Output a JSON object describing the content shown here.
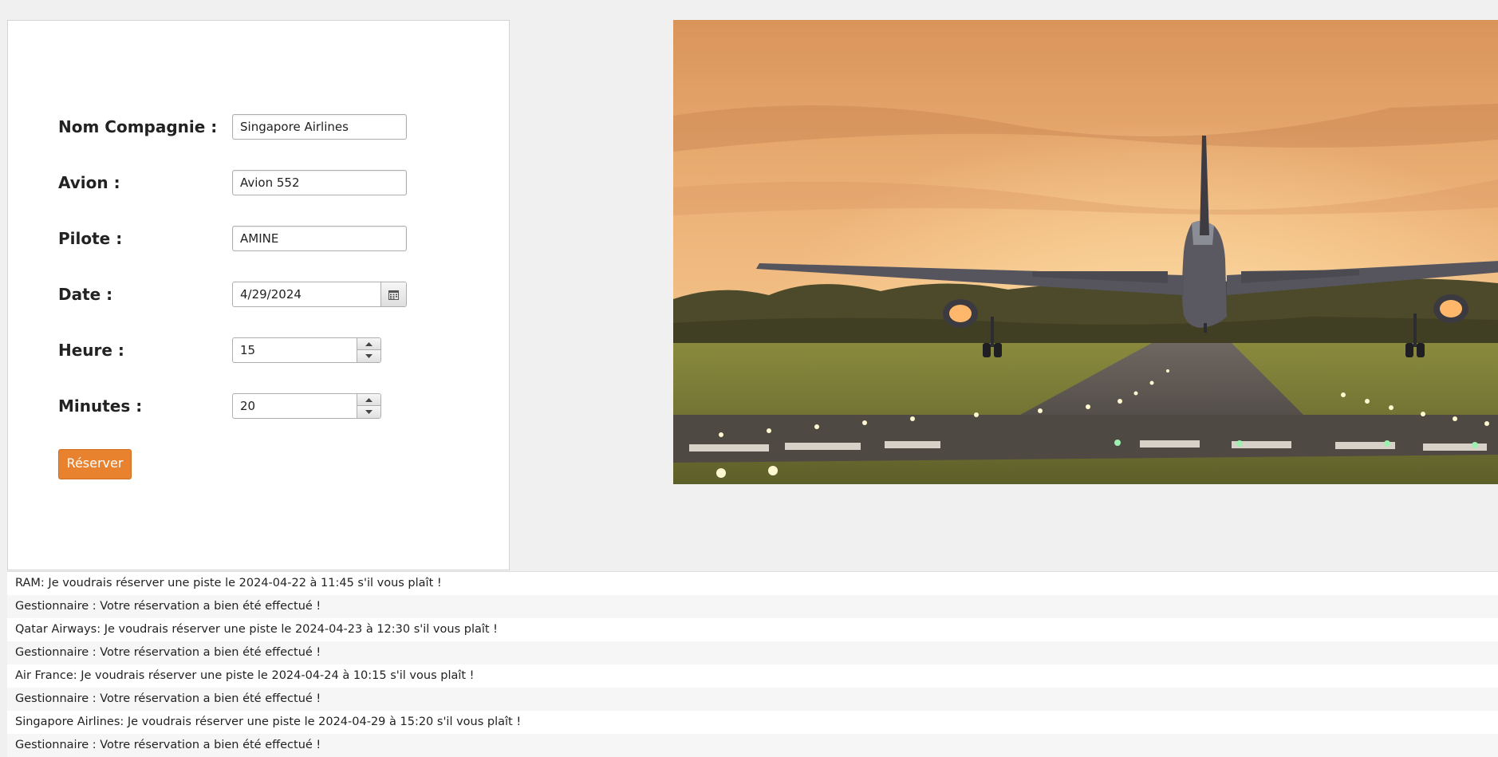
{
  "form": {
    "company": {
      "label": "Nom Compagnie :",
      "value": "Singapore Airlines"
    },
    "plane": {
      "label": "Avion :",
      "value": "Avion 552"
    },
    "pilot": {
      "label": "Pilote :",
      "value": "AMINE"
    },
    "date": {
      "label": "Date :",
      "value": "4/29/2024",
      "icon": "calendar-icon"
    },
    "hour": {
      "label": "Heure :",
      "value": "15"
    },
    "minutes": {
      "label": "Minutes :",
      "value": "20"
    },
    "submit_label": "Réserver"
  },
  "hero_image": {
    "subject": "airplane landing on runway at sunset"
  },
  "colors": {
    "accent": "#e8822f",
    "background": "#f0f0f0"
  },
  "log": [
    "RAM: Je voudrais réserver une piste le 2024-04-22 à 11:45 s'il vous plaît !",
    "Gestionnaire : Votre réservation a bien été effectué !",
    "Qatar Airways: Je voudrais réserver une piste le 2024-04-23 à 12:30 s'il vous plaît !",
    "Gestionnaire : Votre réservation a bien été effectué !",
    "Air France: Je voudrais réserver une piste le 2024-04-24 à 10:15 s'il vous plaît !",
    "Gestionnaire : Votre réservation a bien été effectué !",
    "Singapore Airlines: Je voudrais réserver une piste le 2024-04-29 à 15:20 s'il vous plaît !",
    "Gestionnaire : Votre réservation a bien été effectué !"
  ]
}
